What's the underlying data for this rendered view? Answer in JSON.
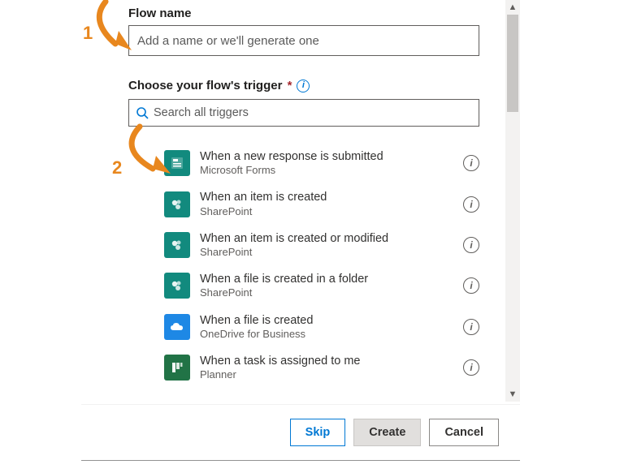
{
  "flowName": {
    "label": "Flow name",
    "placeholder": "Add a name or we'll generate one"
  },
  "triggerSection": {
    "label": "Choose your flow's trigger",
    "required": "*"
  },
  "search": {
    "placeholder": "Search all triggers"
  },
  "triggers": [
    {
      "title": "When a new response is submitted",
      "subtitle": "Microsoft Forms",
      "iconColor": "c-teal",
      "iconGlyph": "forms"
    },
    {
      "title": "When an item is created",
      "subtitle": "SharePoint",
      "iconColor": "c-teal",
      "iconGlyph": "sp"
    },
    {
      "title": "When an item is created or modified",
      "subtitle": "SharePoint",
      "iconColor": "c-teal",
      "iconGlyph": "sp"
    },
    {
      "title": "When a file is created in a folder",
      "subtitle": "SharePoint",
      "iconColor": "c-teal",
      "iconGlyph": "sp"
    },
    {
      "title": "When a file is created",
      "subtitle": "OneDrive for Business",
      "iconColor": "c-blue",
      "iconGlyph": "cloud"
    },
    {
      "title": "When a task is assigned to me",
      "subtitle": "Planner",
      "iconColor": "c-green",
      "iconGlyph": "planner"
    }
  ],
  "buttons": {
    "skip": "Skip",
    "create": "Create",
    "cancel": "Cancel"
  },
  "annotations": {
    "one": "1",
    "two": "2"
  }
}
